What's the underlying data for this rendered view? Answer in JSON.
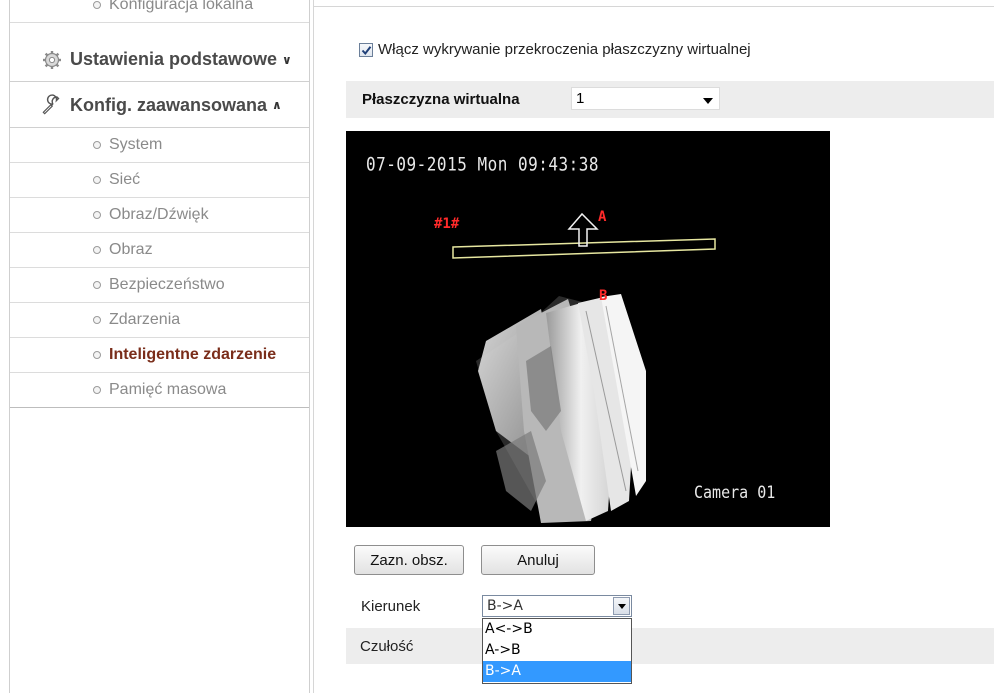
{
  "sidebar": {
    "local_config": "Konfiguracja lokalna",
    "basic_settings": "Ustawienia podstawowe",
    "advanced_config": "Konfig. zaawansowana",
    "items": [
      {
        "label": "System"
      },
      {
        "label": "Sieć"
      },
      {
        "label": "Obraz/Dźwięk"
      },
      {
        "label": "Obraz"
      },
      {
        "label": "Bezpieczeństwo"
      },
      {
        "label": "Zdarzenia"
      },
      {
        "label": "Inteligentne zdarzenie"
      },
      {
        "label": "Pamięć masowa"
      }
    ],
    "active_item": "Inteligentne zdarzenie"
  },
  "main": {
    "enable_label": "Włącz wykrywanie przekroczenia płaszczyzny wirtualnej",
    "enable_checked": true,
    "plane_label": "Płaszczyzna wirtualna",
    "plane_value": "1",
    "video": {
      "timestamp": "07-09-2015 Mon 09:43:38",
      "camera_name": "Camera 01",
      "line_id": "#1#",
      "side_a": "A",
      "side_b": "B"
    },
    "draw_button": "Zazn. obsz.",
    "cancel_button": "Anuluj",
    "direction_label": "Kierunek",
    "direction_value": "B->A",
    "direction_options": [
      "A<->B",
      "A->B",
      "B->A"
    ],
    "sensitivity_label": "Czułość"
  },
  "colors": {
    "active_item": "#7a2d1a",
    "selected_option": "#3399ff",
    "overlay_red": "#ff2a2a",
    "overlay_line": "#e7e7a0"
  }
}
